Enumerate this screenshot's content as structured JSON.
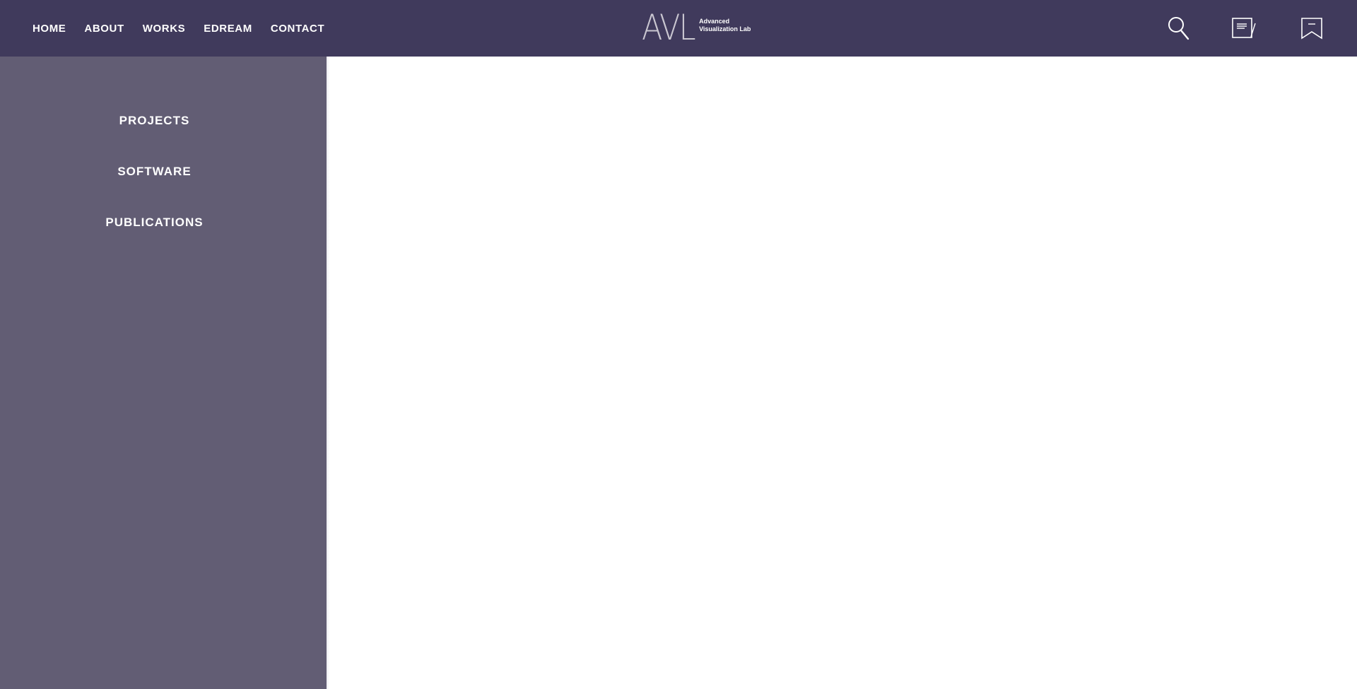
{
  "header": {
    "nav": [
      {
        "label": "HOME"
      },
      {
        "label": "ABOUT"
      },
      {
        "label": "WORKS"
      },
      {
        "label": "EDREAM"
      },
      {
        "label": "CONTACT"
      }
    ],
    "logo": {
      "mark": "AVL",
      "line1": "Advanced",
      "line2": "Visualization Lab"
    },
    "icons": [
      "search-icon",
      "notes-icon",
      "bookmark-icon"
    ]
  },
  "sidebar": {
    "items": [
      {
        "label": "PROJECTS"
      },
      {
        "label": "SOFTWARE"
      },
      {
        "label": "PUBLICATIONS"
      }
    ]
  },
  "colors": {
    "header_bg": "#403a5c",
    "sidebar_bg": "#625d74",
    "content_bg": "#ffffff",
    "text": "#ffffff"
  }
}
